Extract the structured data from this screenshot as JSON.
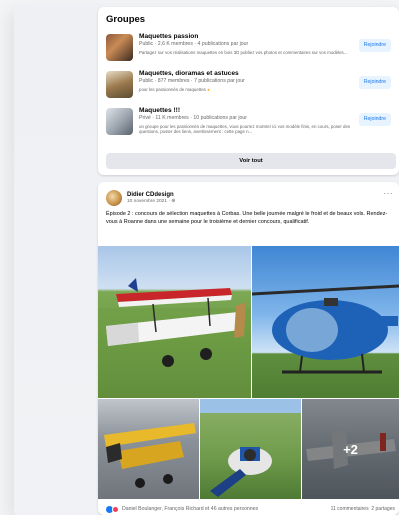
{
  "groups": {
    "title": "Groupes",
    "join_label": "Rejoindre",
    "see_all_label": "Voir tout",
    "items": [
      {
        "name": "Maquettes passion",
        "meta": "Public · 2,6 K membres · 4 publications par jour",
        "description": "Partagez sur vos réalisations maquettes en bois 3D publiez vos photos et commentaires sur vos modèles..."
      },
      {
        "name": "Maquettes, dioramas et astuces",
        "meta": "Public · 877 membres · 7 publications par jour",
        "description": "pour les passionnés de maquettes"
      },
      {
        "name": "Maquettes !!!",
        "meta": "Privé · 11 K membres · 10 publications par jour",
        "description": "un groupe pour les passionnés de maquettes, vous pourrez montrer ici vos modèle finis, en cours, poser des questions, poster des liens, avertissement : cette page n..."
      }
    ]
  },
  "post": {
    "author": "Didier CDdesign",
    "date": "10 novembre 2021",
    "text": "Épisode 2 : concours de sélection maquettes à Corbas. Une belle journée malgré le froid et de beaux vols. Rendez-vous à Roanne dans une semaine pour le troisième et dernier concours, qualificatif.",
    "more_photos": "+2",
    "reactors": "Daniel Boulanger, François Richard et 46 autres personnes",
    "comments": "11 commentaires",
    "shares": "2 partages"
  },
  "colors": {
    "accent": "#1877f2",
    "join_bg": "#e7f3ff",
    "button_bg": "#e4e6eb",
    "secondary_text": "#65676b"
  }
}
